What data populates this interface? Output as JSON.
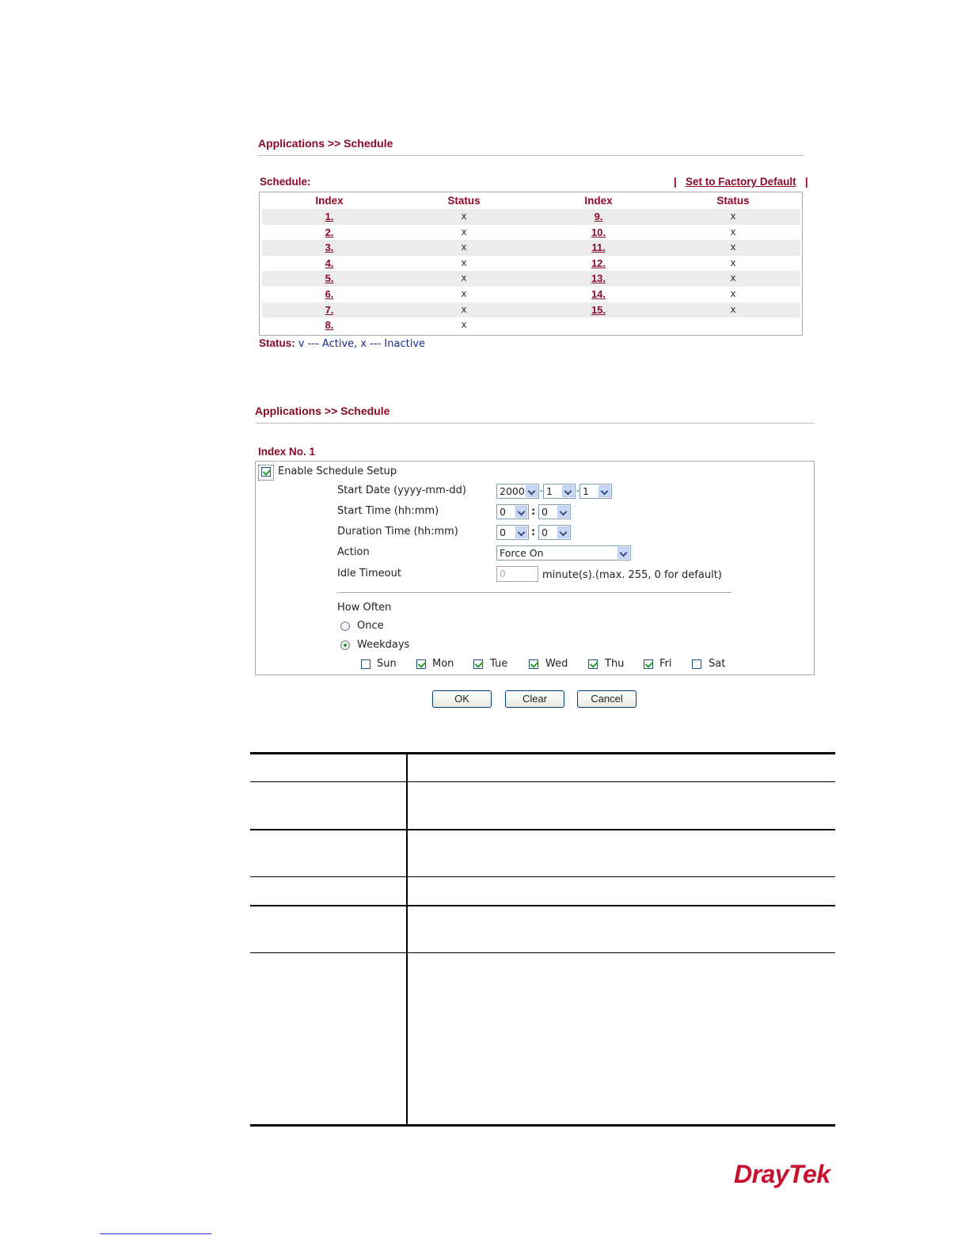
{
  "panel1": {
    "breadcrumb": "Applications >> Schedule",
    "schedule_label": "Schedule:",
    "factory_sep_left": "|",
    "factory_link": "Set to Factory Default",
    "factory_sep_right": "|",
    "headers": [
      "Index",
      "Status",
      "Index",
      "Status"
    ],
    "rows": [
      {
        "left_index": "1.",
        "left_status": "x",
        "right_index": "9.",
        "right_status": "x"
      },
      {
        "left_index": "2.",
        "left_status": "x",
        "right_index": "10.",
        "right_status": "x"
      },
      {
        "left_index": "3.",
        "left_status": "x",
        "right_index": "11.",
        "right_status": "x"
      },
      {
        "left_index": "4.",
        "left_status": "x",
        "right_index": "12.",
        "right_status": "x"
      },
      {
        "left_index": "5.",
        "left_status": "x",
        "right_index": "13.",
        "right_status": "x"
      },
      {
        "left_index": "6.",
        "left_status": "x",
        "right_index": "14.",
        "right_status": "x"
      },
      {
        "left_index": "7.",
        "left_status": "x",
        "right_index": "15.",
        "right_status": "x"
      },
      {
        "left_index": "8.",
        "left_status": "x",
        "right_index": "",
        "right_status": ""
      }
    ],
    "legend_label": "Status:",
    "legend_text": " v --- Active, x --- Inactive"
  },
  "panel2": {
    "breadcrumb": "Applications >> Schedule",
    "index_title": "Index No. 1",
    "enable_label": "Enable Schedule Setup",
    "enable_checked": true,
    "start_date_label": "Start Date (yyyy-mm-dd)",
    "start_date": {
      "year": "2000",
      "month": "1",
      "day": "1"
    },
    "start_time_label": "Start Time (hh:mm)",
    "start_time": {
      "hh": "0",
      "mm": "0"
    },
    "duration_label": "Duration Time (hh:mm)",
    "duration": {
      "hh": "0",
      "mm": "0"
    },
    "time_sep": ":",
    "date_sep": "-",
    "action_label": "Action",
    "action_value": "Force On",
    "idle_label": "Idle Timeout",
    "idle_value": "0",
    "idle_hint": "minute(s).(max. 255, 0 for default)",
    "how_often_label": "How Often",
    "once_label": "Once",
    "weekdays_label": "Weekdays",
    "frequency": "Weekdays",
    "days": [
      {
        "label": "Sun",
        "checked": false
      },
      {
        "label": "Mon",
        "checked": true
      },
      {
        "label": "Tue",
        "checked": true
      },
      {
        "label": "Wed",
        "checked": true
      },
      {
        "label": "Thu",
        "checked": true
      },
      {
        "label": "Fri",
        "checked": true
      },
      {
        "label": "Sat",
        "checked": false
      }
    ],
    "buttons": {
      "ok": "OK",
      "clear": "Clear",
      "cancel": "Cancel"
    }
  },
  "brand": {
    "logo": "DrayTek",
    "color": "#c8102e"
  }
}
